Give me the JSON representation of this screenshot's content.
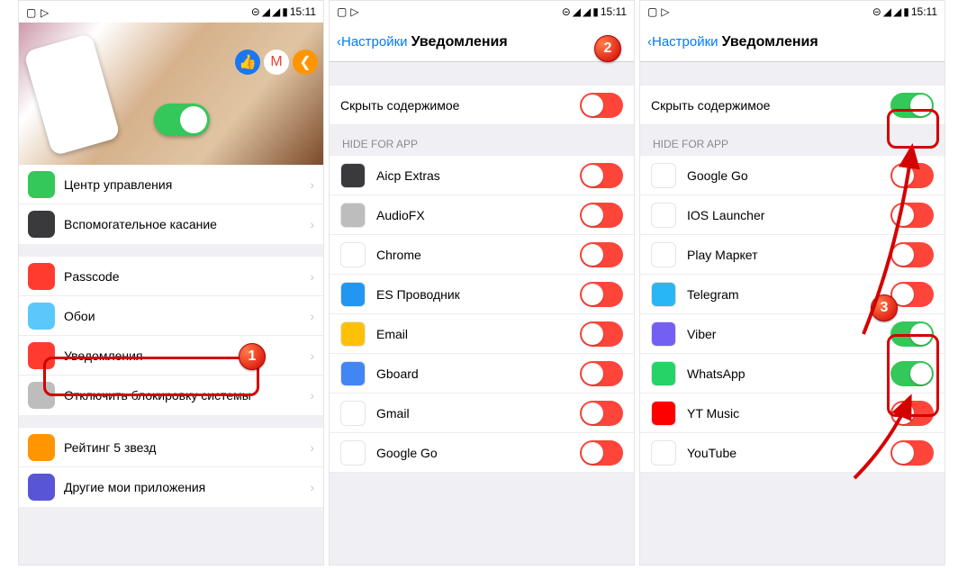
{
  "status": {
    "time": "15:11"
  },
  "screen1": {
    "items1": [
      {
        "label": "Центр управления",
        "color": "#34c759"
      },
      {
        "label": "Вспомогательное касание",
        "color": "#3a3a3c"
      }
    ],
    "items2": [
      {
        "label": "Passcode",
        "color": "#ff3b30"
      },
      {
        "label": "Обои",
        "color": "#5ac8fa"
      },
      {
        "label": "Уведомления",
        "color": "#ff3b30"
      },
      {
        "label": "Отключить блокировку системы",
        "color": "#bdbdbd"
      }
    ],
    "items3": [
      {
        "label": "Рейтинг 5 звезд",
        "color": "#ff9500"
      },
      {
        "label": "Другие мои приложения",
        "color": "#5856d6"
      }
    ]
  },
  "nav": {
    "back": "Настройки",
    "title": "Уведомления"
  },
  "hideContent": "Скрыть содержимое",
  "sectionLabel": "HIDE FOR APP",
  "screen2": {
    "hideContentOn": false,
    "apps": [
      {
        "name": "Aicp Extras",
        "color": "#3a3a3c",
        "on": false
      },
      {
        "name": "AudioFX",
        "color": "#bdbdbd",
        "on": false
      },
      {
        "name": "Chrome",
        "color": "#fff",
        "on": false
      },
      {
        "name": "ES Проводник",
        "color": "#2196f3",
        "on": false
      },
      {
        "name": "Email",
        "color": "#ffc107",
        "on": false
      },
      {
        "name": "Gboard",
        "color": "#4285f4",
        "on": false
      },
      {
        "name": "Gmail",
        "color": "#fff",
        "on": false
      },
      {
        "name": "Google Go",
        "color": "#fff",
        "on": false
      }
    ]
  },
  "screen3": {
    "hideContentOn": true,
    "apps": [
      {
        "name": "Google Go",
        "color": "#fff",
        "on": false
      },
      {
        "name": "IOS Launcher",
        "color": "#fff",
        "on": false
      },
      {
        "name": "Play Маркет",
        "color": "#fff",
        "on": false
      },
      {
        "name": "Telegram",
        "color": "#29b6f6",
        "on": false
      },
      {
        "name": "Viber",
        "color": "#7360f2",
        "on": true
      },
      {
        "name": "WhatsApp",
        "color": "#25d366",
        "on": true
      },
      {
        "name": "YT Music",
        "color": "#ff0000",
        "on": false
      },
      {
        "name": "YouTube",
        "color": "#fff",
        "on": false
      }
    ]
  },
  "badges": {
    "b1": "1",
    "b2": "2",
    "b3": "3"
  }
}
